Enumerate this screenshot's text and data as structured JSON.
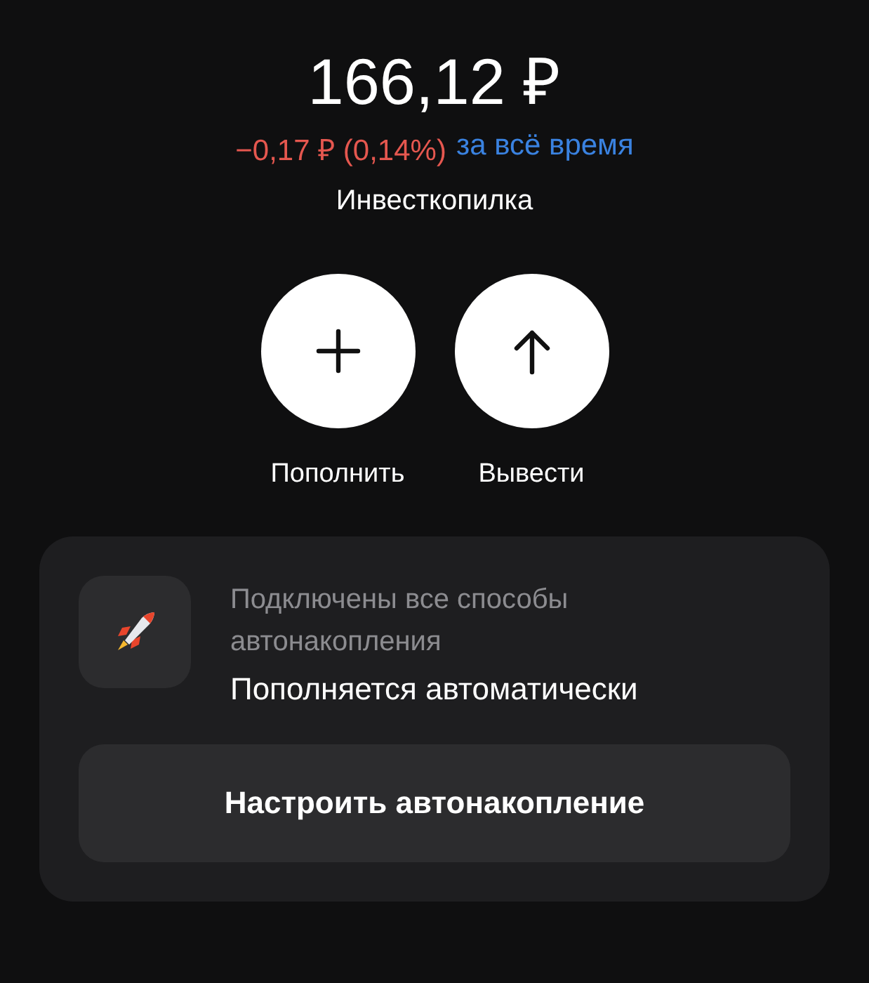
{
  "balance": "166,12 ₽",
  "change": {
    "value": "−0,17 ₽ (0,14%)",
    "period": "за всё время"
  },
  "account_name": "Инвесткопилка",
  "actions": [
    {
      "kind": "add",
      "label": "Пополнить"
    },
    {
      "kind": "withdraw",
      "label": "Вывести"
    }
  ],
  "autosave_card": {
    "subtitle": "Подключены все способы автонакопления",
    "title": "Пополняется автоматически",
    "button": "Настроить автонакопление"
  }
}
